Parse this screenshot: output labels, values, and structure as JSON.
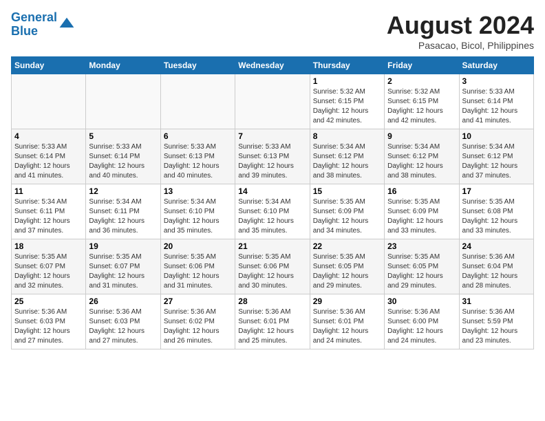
{
  "header": {
    "logo_line1": "General",
    "logo_line2": "Blue",
    "month": "August 2024",
    "location": "Pasacao, Bicol, Philippines"
  },
  "weekdays": [
    "Sunday",
    "Monday",
    "Tuesday",
    "Wednesday",
    "Thursday",
    "Friday",
    "Saturday"
  ],
  "weeks": [
    [
      {
        "day": "",
        "info": ""
      },
      {
        "day": "",
        "info": ""
      },
      {
        "day": "",
        "info": ""
      },
      {
        "day": "",
        "info": ""
      },
      {
        "day": "1",
        "info": "Sunrise: 5:32 AM\nSunset: 6:15 PM\nDaylight: 12 hours\nand 42 minutes."
      },
      {
        "day": "2",
        "info": "Sunrise: 5:32 AM\nSunset: 6:15 PM\nDaylight: 12 hours\nand 42 minutes."
      },
      {
        "day": "3",
        "info": "Sunrise: 5:33 AM\nSunset: 6:14 PM\nDaylight: 12 hours\nand 41 minutes."
      }
    ],
    [
      {
        "day": "4",
        "info": "Sunrise: 5:33 AM\nSunset: 6:14 PM\nDaylight: 12 hours\nand 41 minutes."
      },
      {
        "day": "5",
        "info": "Sunrise: 5:33 AM\nSunset: 6:14 PM\nDaylight: 12 hours\nand 40 minutes."
      },
      {
        "day": "6",
        "info": "Sunrise: 5:33 AM\nSunset: 6:13 PM\nDaylight: 12 hours\nand 40 minutes."
      },
      {
        "day": "7",
        "info": "Sunrise: 5:33 AM\nSunset: 6:13 PM\nDaylight: 12 hours\nand 39 minutes."
      },
      {
        "day": "8",
        "info": "Sunrise: 5:34 AM\nSunset: 6:12 PM\nDaylight: 12 hours\nand 38 minutes."
      },
      {
        "day": "9",
        "info": "Sunrise: 5:34 AM\nSunset: 6:12 PM\nDaylight: 12 hours\nand 38 minutes."
      },
      {
        "day": "10",
        "info": "Sunrise: 5:34 AM\nSunset: 6:12 PM\nDaylight: 12 hours\nand 37 minutes."
      }
    ],
    [
      {
        "day": "11",
        "info": "Sunrise: 5:34 AM\nSunset: 6:11 PM\nDaylight: 12 hours\nand 37 minutes."
      },
      {
        "day": "12",
        "info": "Sunrise: 5:34 AM\nSunset: 6:11 PM\nDaylight: 12 hours\nand 36 minutes."
      },
      {
        "day": "13",
        "info": "Sunrise: 5:34 AM\nSunset: 6:10 PM\nDaylight: 12 hours\nand 35 minutes."
      },
      {
        "day": "14",
        "info": "Sunrise: 5:34 AM\nSunset: 6:10 PM\nDaylight: 12 hours\nand 35 minutes."
      },
      {
        "day": "15",
        "info": "Sunrise: 5:35 AM\nSunset: 6:09 PM\nDaylight: 12 hours\nand 34 minutes."
      },
      {
        "day": "16",
        "info": "Sunrise: 5:35 AM\nSunset: 6:09 PM\nDaylight: 12 hours\nand 33 minutes."
      },
      {
        "day": "17",
        "info": "Sunrise: 5:35 AM\nSunset: 6:08 PM\nDaylight: 12 hours\nand 33 minutes."
      }
    ],
    [
      {
        "day": "18",
        "info": "Sunrise: 5:35 AM\nSunset: 6:07 PM\nDaylight: 12 hours\nand 32 minutes."
      },
      {
        "day": "19",
        "info": "Sunrise: 5:35 AM\nSunset: 6:07 PM\nDaylight: 12 hours\nand 31 minutes."
      },
      {
        "day": "20",
        "info": "Sunrise: 5:35 AM\nSunset: 6:06 PM\nDaylight: 12 hours\nand 31 minutes."
      },
      {
        "day": "21",
        "info": "Sunrise: 5:35 AM\nSunset: 6:06 PM\nDaylight: 12 hours\nand 30 minutes."
      },
      {
        "day": "22",
        "info": "Sunrise: 5:35 AM\nSunset: 6:05 PM\nDaylight: 12 hours\nand 29 minutes."
      },
      {
        "day": "23",
        "info": "Sunrise: 5:35 AM\nSunset: 6:05 PM\nDaylight: 12 hours\nand 29 minutes."
      },
      {
        "day": "24",
        "info": "Sunrise: 5:36 AM\nSunset: 6:04 PM\nDaylight: 12 hours\nand 28 minutes."
      }
    ],
    [
      {
        "day": "25",
        "info": "Sunrise: 5:36 AM\nSunset: 6:03 PM\nDaylight: 12 hours\nand 27 minutes."
      },
      {
        "day": "26",
        "info": "Sunrise: 5:36 AM\nSunset: 6:03 PM\nDaylight: 12 hours\nand 27 minutes."
      },
      {
        "day": "27",
        "info": "Sunrise: 5:36 AM\nSunset: 6:02 PM\nDaylight: 12 hours\nand 26 minutes."
      },
      {
        "day": "28",
        "info": "Sunrise: 5:36 AM\nSunset: 6:01 PM\nDaylight: 12 hours\nand 25 minutes."
      },
      {
        "day": "29",
        "info": "Sunrise: 5:36 AM\nSunset: 6:01 PM\nDaylight: 12 hours\nand 24 minutes."
      },
      {
        "day": "30",
        "info": "Sunrise: 5:36 AM\nSunset: 6:00 PM\nDaylight: 12 hours\nand 24 minutes."
      },
      {
        "day": "31",
        "info": "Sunrise: 5:36 AM\nSunset: 5:59 PM\nDaylight: 12 hours\nand 23 minutes."
      }
    ]
  ]
}
